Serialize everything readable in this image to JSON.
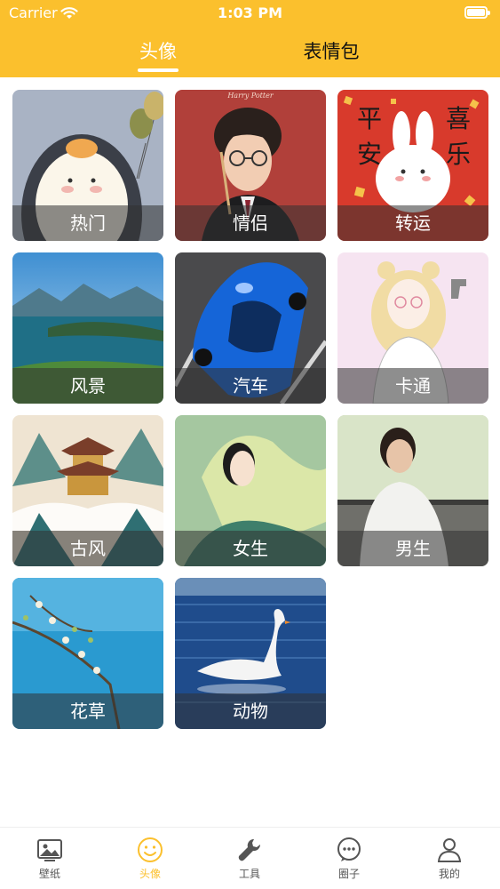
{
  "status_bar": {
    "carrier": "Carrier",
    "time": "1:03 PM"
  },
  "top_tabs": [
    {
      "label": "头像",
      "active": true
    },
    {
      "label": "表情包",
      "active": false
    }
  ],
  "categories": [
    {
      "label": "热门"
    },
    {
      "label": "情侣"
    },
    {
      "label": "转运"
    },
    {
      "label": "风景"
    },
    {
      "label": "汽车"
    },
    {
      "label": "卡通"
    },
    {
      "label": "古风"
    },
    {
      "label": "女生"
    },
    {
      "label": "男生"
    },
    {
      "label": "花草"
    },
    {
      "label": "动物"
    }
  ],
  "category_art": {
    "harry_potter_caption": "Harry Potter",
    "lucky_text": [
      "平",
      "安",
      "喜",
      "乐"
    ]
  },
  "bottom_tabs": [
    {
      "label": "壁纸",
      "icon": "picture-icon"
    },
    {
      "label": "头像",
      "icon": "smiley-icon",
      "active": true
    },
    {
      "label": "工具",
      "icon": "wrench-icon"
    },
    {
      "label": "圈子",
      "icon": "chat-bubble-icon"
    },
    {
      "label": "我的",
      "icon": "user-icon"
    }
  ],
  "colors": {
    "accent": "#fbc02d",
    "header": "#fbc02d"
  }
}
